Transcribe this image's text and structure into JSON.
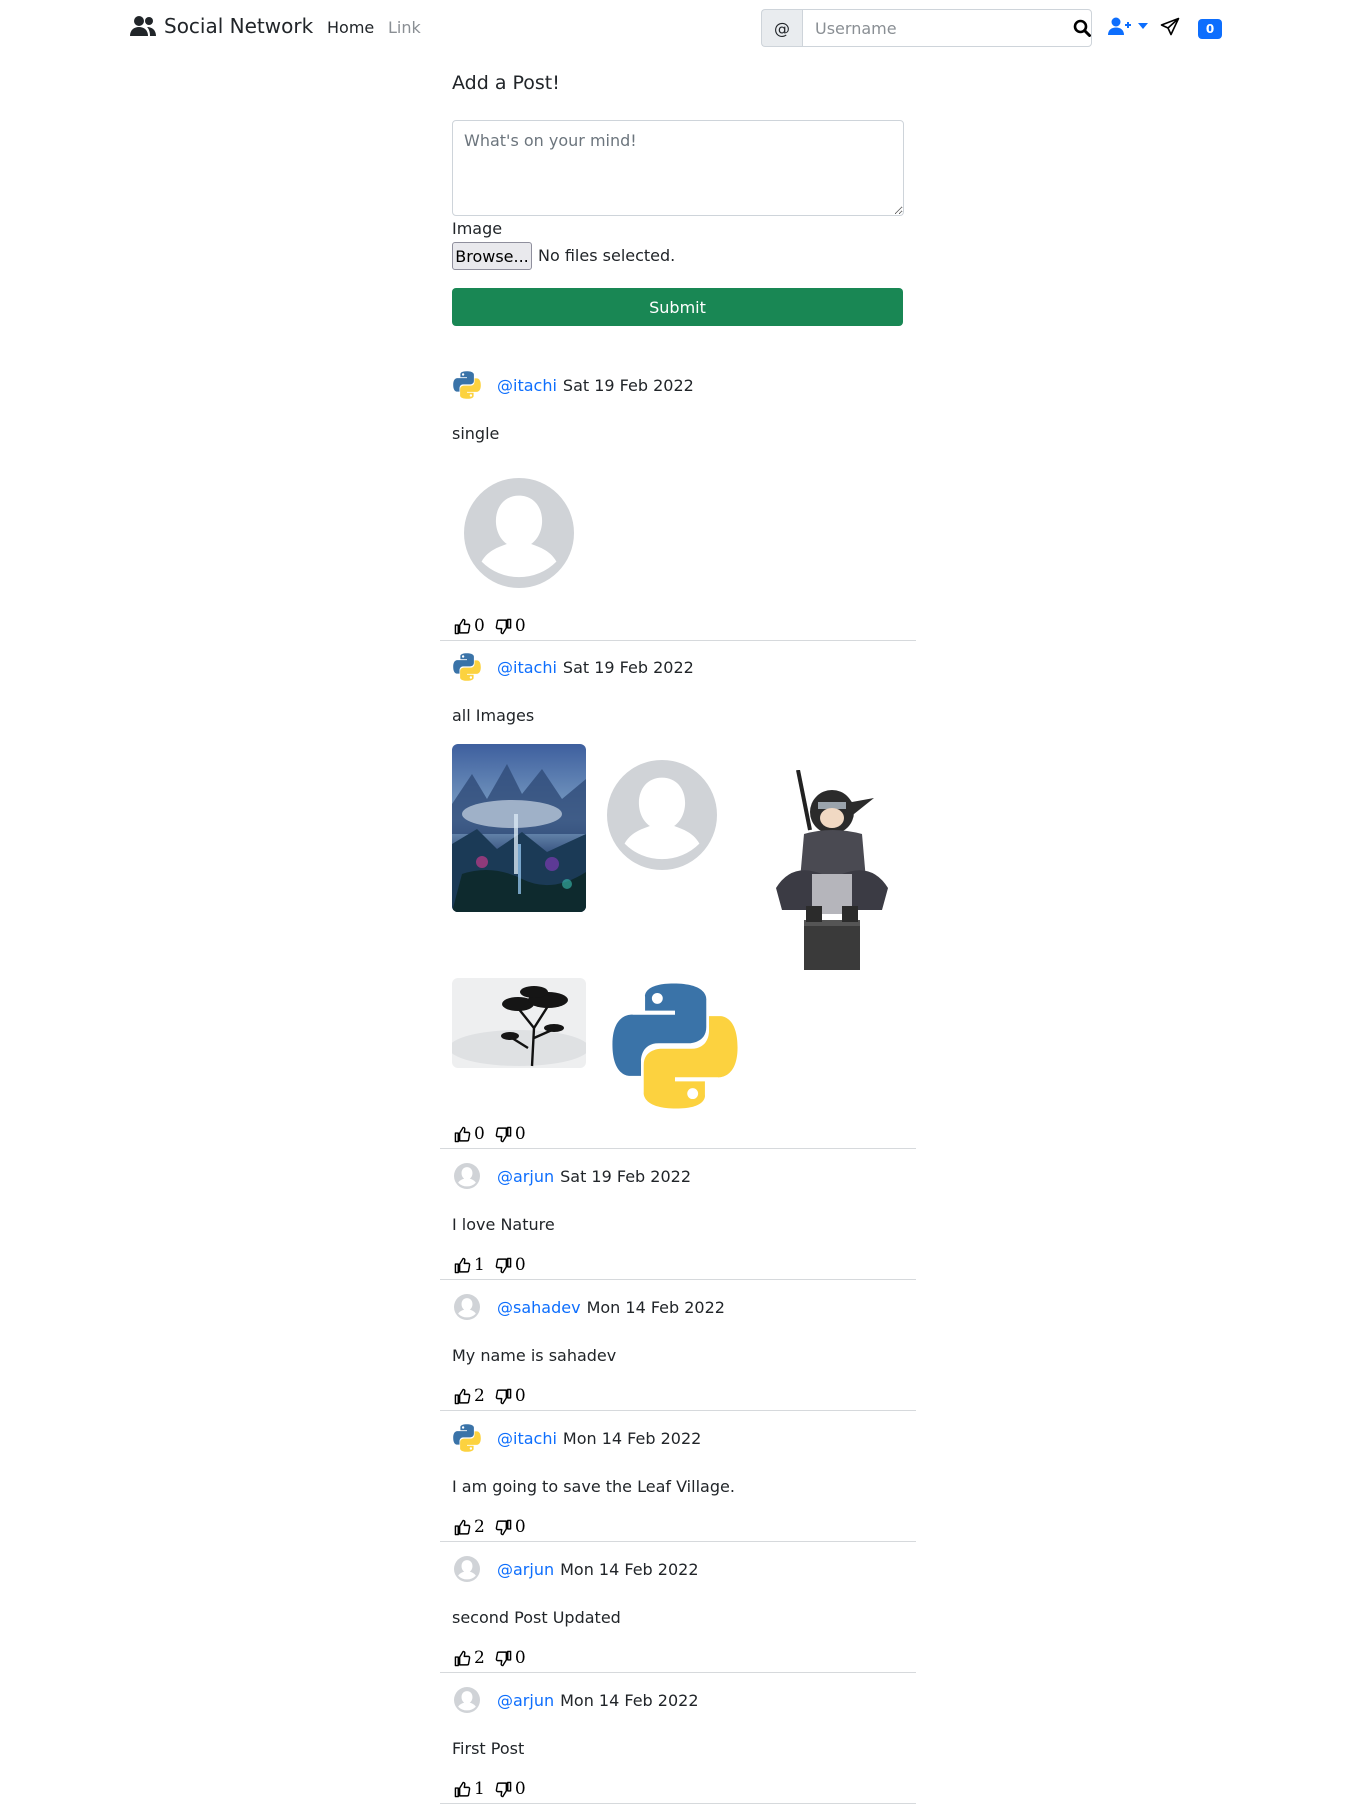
{
  "navbar": {
    "brand": "Social Network",
    "links": [
      "Home",
      "Link"
    ],
    "search_prefix": "@",
    "search_placeholder": "Username",
    "notification_count": "0"
  },
  "form": {
    "title": "Add a Post!",
    "textarea_placeholder": "What's on your mind!",
    "image_label": "Image",
    "browse_label": "Browse...",
    "file_status": "No files selected.",
    "submit_label": "Submit"
  },
  "posts": [
    {
      "user": "@itachi",
      "date": "Sat 19 Feb 2022",
      "text": "single",
      "likes": "0",
      "dislikes": "0",
      "avatar": "python-logo"
    },
    {
      "user": "@itachi",
      "date": "Sat 19 Feb 2022",
      "text": "all Images",
      "likes": "0",
      "dislikes": "0",
      "avatar": "python-logo"
    },
    {
      "user": "@arjun",
      "date": "Sat 19 Feb 2022",
      "text": "I love Nature",
      "likes": "1",
      "dislikes": "0",
      "avatar": "default-avatar"
    },
    {
      "user": "@sahadev",
      "date": "Mon 14 Feb 2022",
      "text": "My name is sahadev",
      "likes": "2",
      "dislikes": "0",
      "avatar": "default-avatar"
    },
    {
      "user": "@itachi",
      "date": "Mon 14 Feb 2022",
      "text": "I am going to save the Leaf Village.",
      "likes": "2",
      "dislikes": "0",
      "avatar": "python-logo"
    },
    {
      "user": "@arjun",
      "date": "Mon 14 Feb 2022",
      "text": "second Post Updated",
      "likes": "2",
      "dislikes": "0",
      "avatar": "default-avatar"
    },
    {
      "user": "@arjun",
      "date": "Mon 14 Feb 2022",
      "text": "First Post",
      "likes": "1",
      "dislikes": "0",
      "avatar": "default-avatar"
    }
  ],
  "colors": {
    "primary": "#0d6efd",
    "success": "#198754",
    "text": "#212529",
    "muted": "#8a8f94"
  }
}
